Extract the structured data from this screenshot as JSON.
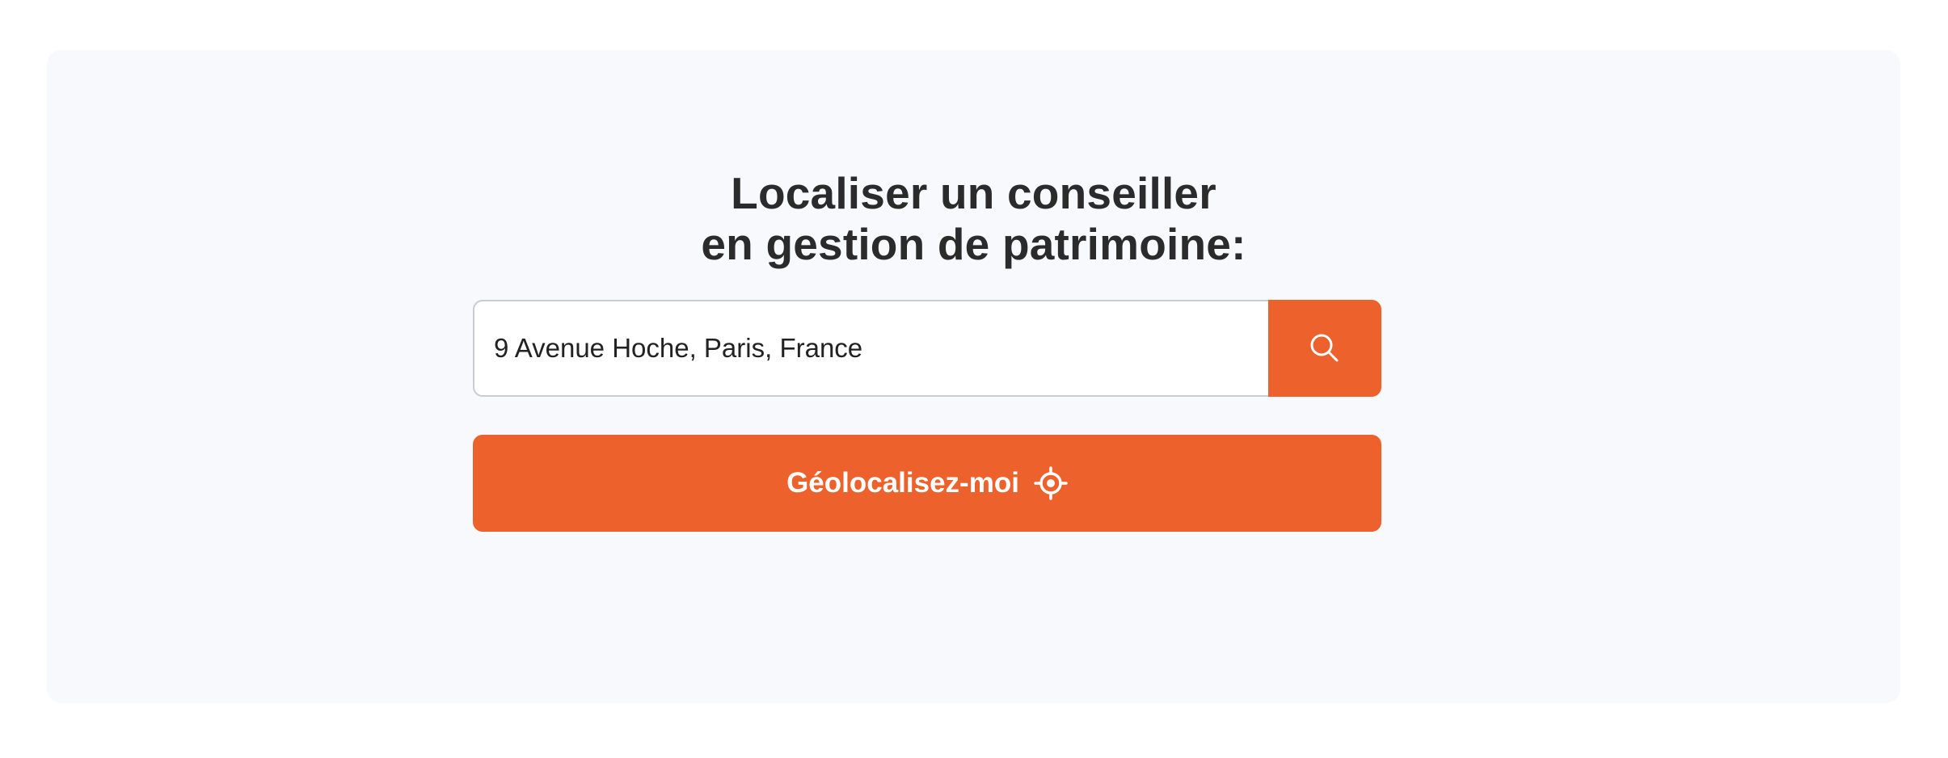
{
  "locator": {
    "title_line1": "Localiser un conseiller",
    "title_line2": "en gestion de patrimoine:",
    "search": {
      "value": "9 Avenue Hoche, Paris, France",
      "button_icon": "search-icon"
    },
    "geolocate": {
      "label": "Géolocalisez-moi",
      "icon": "crosshair-target-icon"
    }
  },
  "colors": {
    "accent": "#ec612c",
    "panel_background": "#f8f9fd",
    "title_text": "#2b2b2b",
    "input_border": "#c9ccd3"
  }
}
